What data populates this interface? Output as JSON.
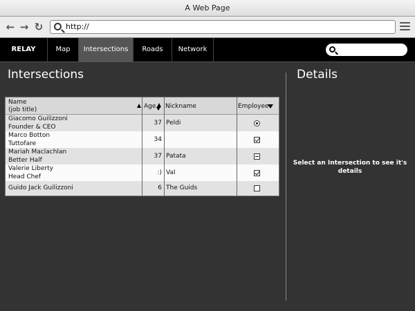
{
  "browser": {
    "title": "A Web Page",
    "url": "http://"
  },
  "nav": {
    "brand": "RELAY",
    "items": [
      "Map",
      "Intersections",
      "Roads",
      "Network"
    ],
    "active": "Intersections",
    "search_value": ""
  },
  "main": {
    "heading": "Intersections",
    "table": {
      "headers": {
        "name_line1": "Name",
        "name_line2": "(job title)",
        "age": "Age",
        "nickname": "Nickname",
        "employee": "Employee"
      },
      "rows": [
        {
          "name": "Giacomo Guilizzoni",
          "title": "Founder & CEO",
          "age": "37",
          "nickname": "Peldi",
          "employee": "radio"
        },
        {
          "name": "Marco Botton",
          "title": "Tuttofare",
          "age": "34",
          "nickname": "",
          "employee": "checked"
        },
        {
          "name": "Mariah Maclachlan",
          "title": "Better Half",
          "age": "37",
          "nickname": "Patata",
          "employee": "indeterminate"
        },
        {
          "name": "Valerie Liberty",
          "title": "Head Chef",
          "age": ":)",
          "nickname": "Val",
          "employee": "checked"
        },
        {
          "name": "Guido Jack Guilizzoni",
          "title": "",
          "age": "6",
          "nickname": "The Guids",
          "employee": "unchecked"
        }
      ]
    }
  },
  "details": {
    "heading": "Details",
    "message": "Select an Intersection to see it's details"
  }
}
